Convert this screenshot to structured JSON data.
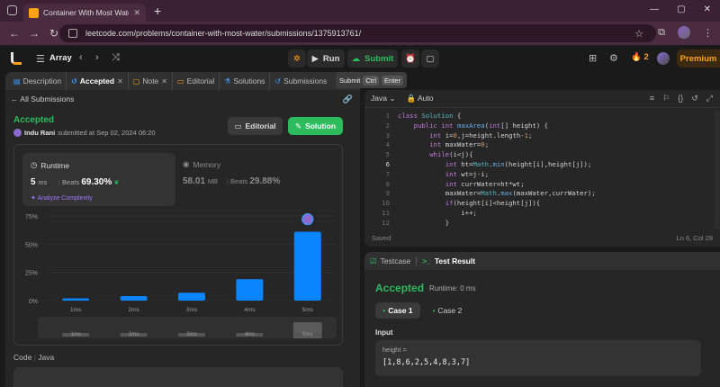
{
  "browser": {
    "tab_title": "Container With Most Water - Le",
    "url": "leetcode.com/problems/container-with-most-water/submissions/1375913761/"
  },
  "nav": {
    "problem_list": "Array",
    "run": "Run",
    "submit": "Submit",
    "streak": "2",
    "premium": "Premium"
  },
  "left_tabs": [
    {
      "label": "Description"
    },
    {
      "label": "Accepted"
    },
    {
      "label": "Note"
    },
    {
      "label": "Editorial"
    },
    {
      "label": "Solutions"
    },
    {
      "label": "Submissions"
    }
  ],
  "shortcut_tip": {
    "label": "Submit",
    "k1": "Ctrl",
    "k2": "Enter"
  },
  "submission": {
    "back_link": "All Submissions",
    "status": "Accepted",
    "user": "Indu Rani",
    "submitted": "submitted at Sep 02, 2024 06:20",
    "editorial_btn": "Editorial",
    "solution_btn": "Solution"
  },
  "runtime": {
    "label": "Runtime",
    "value": "5",
    "unit": "ms",
    "beats_label": "Beats",
    "beats": "69.30%",
    "analyze": "Analyze Complexity"
  },
  "memory": {
    "label": "Memory",
    "value": "58.01",
    "unit": "MB",
    "beats_label": "Beats",
    "beats": "29.88%"
  },
  "code_header": {
    "code": "Code",
    "lang": "Java"
  },
  "chart_data": {
    "type": "bar",
    "categories": [
      "1ms",
      "2ms",
      "3ms",
      "4ms",
      "5ms"
    ],
    "values": [
      2,
      4,
      7,
      19,
      61
    ],
    "yticks": [
      "75%",
      "50%",
      "25%",
      "0%"
    ],
    "ylim": [
      0,
      75
    ],
    "highlight_index": 4,
    "bar_color": "#0a84ff",
    "highlight_color": "#0a84ff"
  },
  "editor": {
    "lang": "Java",
    "mode": "Auto",
    "status": "Saved",
    "cursor": "Ln 6, Col 28",
    "lines": [
      "class Solution {",
      "    public int maxArea(int[] height) {",
      "        int i=0,j=height.length-1;",
      "        int maxWater=0;",
      "        while(i<j){",
      "            int ht=Math.min(height[i],height[j]);",
      "            int wt=j-i;",
      "            int currWater=ht*wt;",
      "            maxWater=Math.max(maxWater,currWater);",
      "            if(height[i]<height[j]){",
      "                i++;",
      "            }"
    ]
  },
  "result": {
    "tab_testcase": "Testcase",
    "tab_result": "Test Result",
    "status": "Accepted",
    "runtime": "Runtime: 0 ms",
    "case1": "Case 1",
    "case2": "Case 2",
    "input_label": "Input",
    "var_name": "height =",
    "var_value": "[1,8,6,2,5,4,8,3,7]"
  }
}
